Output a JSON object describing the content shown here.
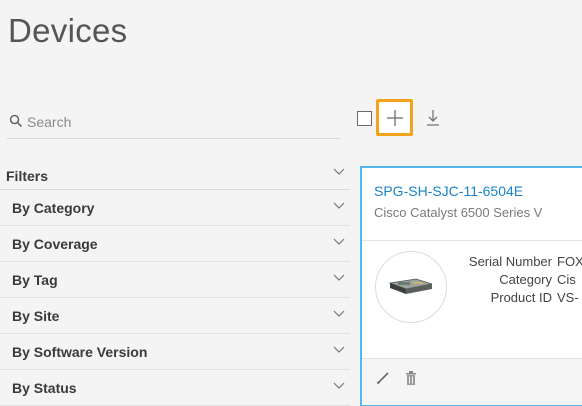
{
  "page": {
    "title": "Devices"
  },
  "search": {
    "placeholder": "Search",
    "value": ""
  },
  "toolbar": {
    "select_all_icon": "checkbox-empty",
    "add_icon": "plus-icon",
    "download_icon": "download-icon",
    "highlight_color": "#f3a21b"
  },
  "filters": {
    "header": "Filters",
    "items": [
      {
        "label": "By Category"
      },
      {
        "label": "By Coverage"
      },
      {
        "label": "By Tag"
      },
      {
        "label": "By Site"
      },
      {
        "label": "By Software Version"
      },
      {
        "label": "By Status"
      }
    ]
  },
  "device_card": {
    "name": "SPG-SH-SJC-11-6504E",
    "model": "Cisco Catalyst 6500 Series V",
    "specs": [
      {
        "key": "Serial Number",
        "value": "FOX"
      },
      {
        "key": "Category",
        "value": "Cis"
      },
      {
        "key": "Product ID",
        "value": "VS-"
      }
    ],
    "accent_color": "#55b8ea",
    "link_color": "#1a83c7",
    "actions": {
      "edit_icon": "pencil-icon",
      "delete_icon": "trash-icon"
    }
  }
}
